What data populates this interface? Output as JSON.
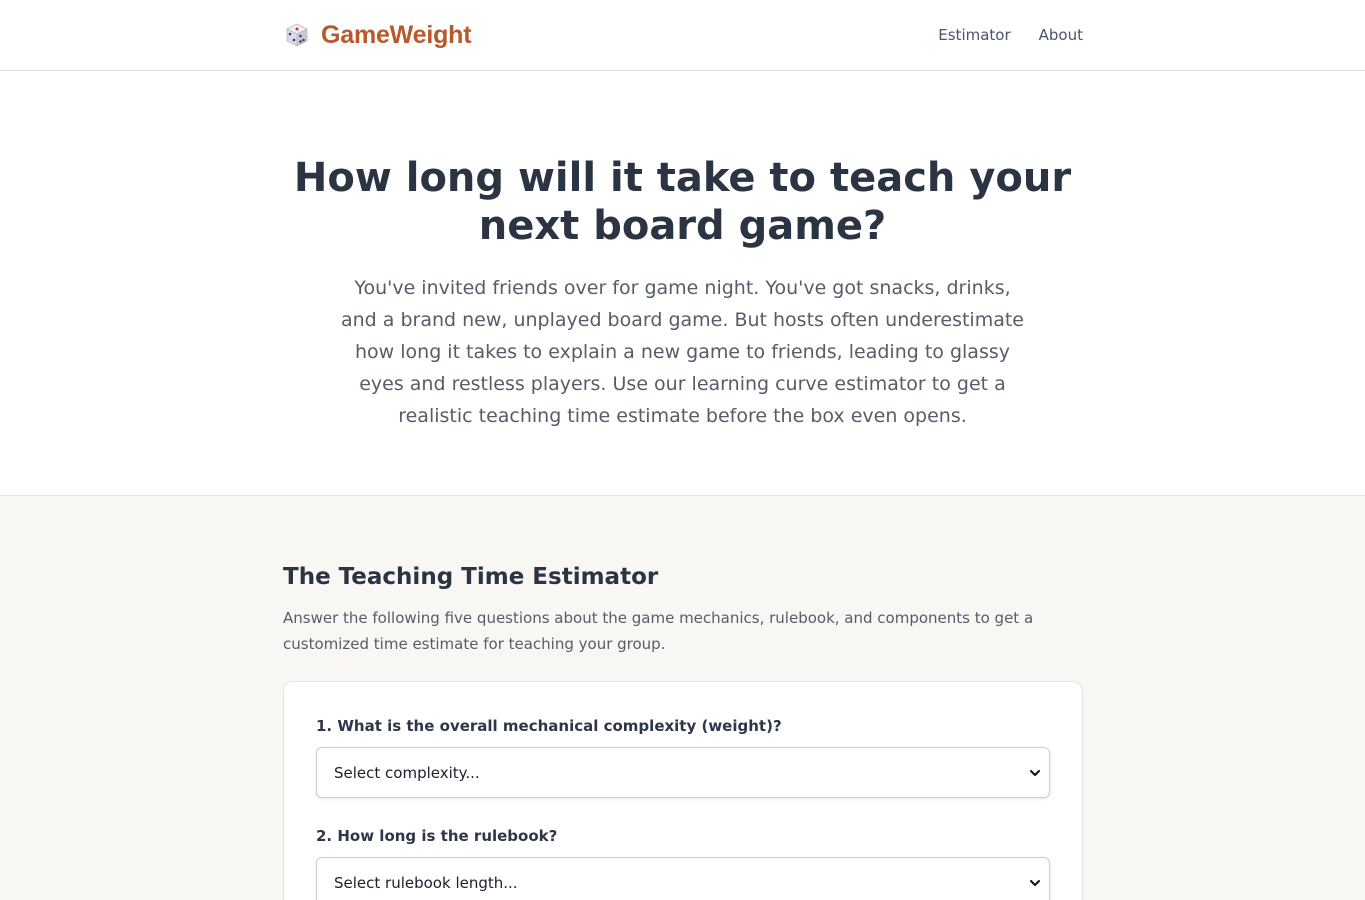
{
  "header": {
    "brand": "GameWeight",
    "logo_icon": "dice-icon",
    "nav": [
      "Estimator",
      "About"
    ],
    "brand_color": "#b9582a"
  },
  "hero": {
    "title": "How long will it take to teach your next board game?",
    "body": "You've invited friends over for game night. You've got snacks, drinks, and a brand new, unplayed board game. But hosts often underestimate how long it takes to explain a new game to friends, leading to glassy eyes and restless players. Use our learning curve estimator to get a realistic teaching time estimate before the box even opens."
  },
  "estimator": {
    "title": "The Teaching Time Estimator",
    "description": "Answer the following five questions about the game mechanics, rulebook, and components to get a customized time estimate for teaching your group.",
    "questions": [
      {
        "label": "1. What is the overall mechanical complexity (weight)?",
        "selected": "Select complexity..."
      },
      {
        "label": "2. How long is the rulebook?",
        "selected": "Select rulebook length..."
      }
    ]
  }
}
